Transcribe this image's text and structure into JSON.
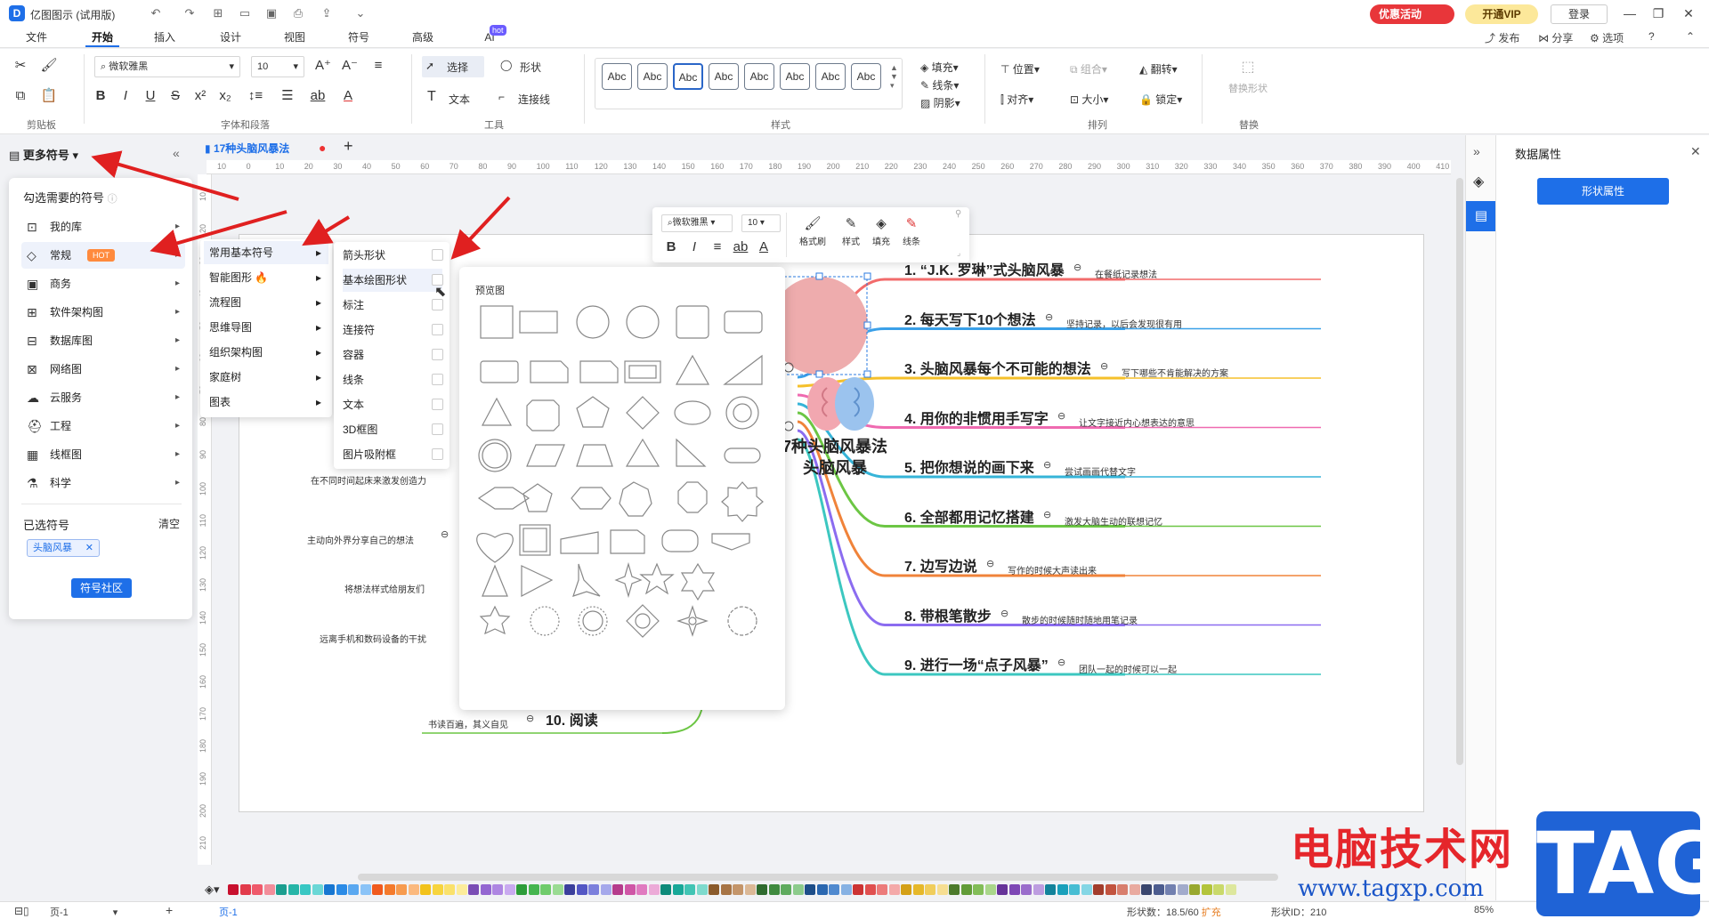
{
  "app": {
    "title": "亿图图示 (试用版)",
    "promo": "优惠活动",
    "vip": "开通VIP",
    "login": "登录"
  },
  "menu_tabs": [
    "文件",
    "开始",
    "插入",
    "设计",
    "视图",
    "符号",
    "高级",
    "AI"
  ],
  "ai_badge": "hot",
  "right_tools": [
    "发布",
    "分享",
    "选项"
  ],
  "ribbon": {
    "font_name": "微软雅黑",
    "font_size": "10",
    "select": "选择",
    "shape": "形状",
    "text": "文本",
    "connector": "连接线",
    "style_abc": "Abc",
    "fill": "填充",
    "line": "线条",
    "shadow": "阴影",
    "position": "位置",
    "group": "组合",
    "flip": "翻转",
    "align": "对齐",
    "size": "大小",
    "lock": "锁定",
    "replace_shape": "替换形状",
    "groups": [
      "剪贴板",
      "字体和段落",
      "工具",
      "样式",
      "排列",
      "替换"
    ]
  },
  "left_panel": {
    "more_symbols": "更多符号",
    "pick_label": "勾选需要的符号",
    "categories": [
      "我的库",
      "常规",
      "商务",
      "软件架构图",
      "数据库图",
      "网络图",
      "云服务",
      "工程",
      "线框图",
      "科学"
    ],
    "hot_badge": "HOT",
    "selected_label": "已选符号",
    "clear": "清空",
    "selected_tag": "头脑风暴",
    "community": "符号社区"
  },
  "submenu1": [
    "常用基本符号",
    "智能图形",
    "流程图",
    "思维导图",
    "组织架构图",
    "家庭树",
    "图表"
  ],
  "submenu2": [
    "箭头形状",
    "基本绘图形状",
    "标注",
    "连接符",
    "容器",
    "线条",
    "文本",
    "3D框图",
    "图片吸附框"
  ],
  "preview_label": "预览图",
  "doc_tab": "17种头脑风暴法",
  "ruler_marks": [
    "10",
    "0",
    "10",
    "20",
    "30",
    "40",
    "50",
    "60",
    "70",
    "80",
    "90",
    "100",
    "110",
    "120",
    "130",
    "140",
    "150",
    "160",
    "170",
    "180",
    "190",
    "200",
    "210",
    "220",
    "230",
    "240",
    "250",
    "260",
    "270",
    "280",
    "290",
    "300",
    "310",
    "320",
    "330",
    "340",
    "350",
    "360",
    "370",
    "380",
    "390",
    "400",
    "410"
  ],
  "vruler_marks": [
    "10",
    "20",
    "30",
    "40",
    "50",
    "60",
    "70",
    "80",
    "90",
    "100",
    "110",
    "120",
    "130",
    "140",
    "150",
    "160",
    "170",
    "180",
    "190",
    "200",
    "210"
  ],
  "float_toolbar": {
    "font": "微软雅黑",
    "size": "10",
    "format_brush": "格式刷",
    "style": "样式",
    "fill": "填充",
    "line": "线条"
  },
  "mindmap": {
    "center_line1": "7种头脑风暴法",
    "center_line2": "头脑风暴",
    "topics": [
      {
        "title": "1. “J.K. 罗琳”式头脑风暴",
        "note": "在餐纸记录想法",
        "color": "#f26b6b"
      },
      {
        "title": "2. 每天写下10个想法",
        "note": "坚持记录，以后会发现很有用",
        "color": "#3aa0e8"
      },
      {
        "title": "3. 头脑风暴每个不可能的想法",
        "note": "写下哪些不肯能解决的方案",
        "color": "#f5c02b"
      },
      {
        "title": "4. 用你的非惯用手写字",
        "note": "让文字接近内心想表达的意思",
        "color": "#ef6ab0"
      },
      {
        "title": "5. 把你想说的画下来",
        "note": "尝试画画代替文字",
        "color": "#36b4d8"
      },
      {
        "title": "6. 全部都用记忆搭建",
        "note": "激发大脑生动的联想记忆",
        "color": "#6cc644"
      },
      {
        "title": "7. 边写边说",
        "note": "写作的时候大声读出来",
        "color": "#f0833a"
      },
      {
        "title": "8. 带根笔散步",
        "note": "散步的时候随时随地用笔记录",
        "color": "#8b6cf0"
      },
      {
        "title": "9. 进行一场“点子风暴”",
        "note": "团队一起的时候可以一起",
        "color": "#3cc7c0"
      }
    ],
    "left_notes": [
      "在不同时间起床来激发创造力",
      "主动向外界分享自己的想法",
      "将想法样式给朋友们",
      "远离手机和数码设备的干扰",
      "书读百遍，其义自见"
    ],
    "left_topic10": "10. 阅读"
  },
  "right_panel": {
    "title": "数据属性",
    "button": "形状属性"
  },
  "statusbar": {
    "page_label": "页-1",
    "page_tab": "页-1",
    "shape_count": "形状数：",
    "shape_count_val": "18.5/60",
    "expand": "扩充",
    "shape_id": "形状ID：210",
    "zoom": "85%"
  },
  "watermark": {
    "cn": "电脑技术网",
    "url": "www.tagxp.com",
    "tag": "TAG"
  },
  "palette": [
    "#c8102e",
    "#e23b4b",
    "#ef5a6b",
    "#f28d9a",
    "#1b9e8f",
    "#26b5a7",
    "#38c7c3",
    "#6ad7d6",
    "#1776d1",
    "#2b8be6",
    "#5aa8f0",
    "#8ac3f7",
    "#f05a1e",
    "#f47a2c",
    "#f79b4f",
    "#fbb97e",
    "#f2c21b",
    "#f7d43e",
    "#fae16b",
    "#fcec9b",
    "#7a4db5",
    "#9366d1",
    "#ae86e2",
    "#c9aaf0",
    "#2d9d3a",
    "#45b54f",
    "#6fcb6b",
    "#9adb93",
    "#3b3f9c",
    "#5356c4",
    "#7b7fdc",
    "#a5a8eb",
    "#b53b8c",
    "#cf55a6",
    "#e07ac0",
    "#ecaad8",
    "#0d8a7a",
    "#18a898",
    "#41c4b4",
    "#7edacd",
    "#8a5a2b",
    "#a77445",
    "#c4956a",
    "#dbb896",
    "#2f6b2f",
    "#3f8a3f",
    "#5fab5f",
    "#8ccb8c",
    "#1d4e89",
    "#2a67b0",
    "#4f89cf",
    "#86b1e3",
    "#cc3333",
    "#e04f4f",
    "#ec7b7b",
    "#f4a9a9",
    "#d4a017",
    "#e6b82a",
    "#f0cd5c",
    "#f6de92",
    "#4c7a2b",
    "#629c38",
    "#82bd58",
    "#a9d68a",
    "#663399",
    "#7d47b5",
    "#9a6dcc",
    "#bd9de0",
    "#13839b",
    "#1aa0bb",
    "#47bdd3",
    "#84d6e5",
    "#a23d2c",
    "#c2533f",
    "#d87e6e",
    "#e9aaa0",
    "#39466e",
    "#4c5c8f",
    "#7280b0",
    "#a2abcc",
    "#98a82f",
    "#b3c43b",
    "#c9d96a",
    "#dde79d"
  ]
}
